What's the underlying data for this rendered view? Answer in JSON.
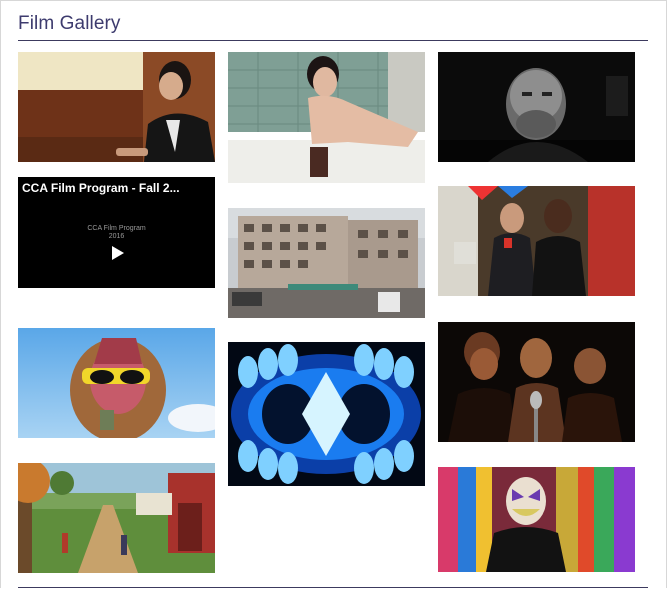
{
  "gallery": {
    "title": "Film Gallery",
    "video_overlay": {
      "title": "CCA Film Program - Fall 2...",
      "center_line1": "CCA Film Program",
      "center_line2": "2016"
    }
  }
}
